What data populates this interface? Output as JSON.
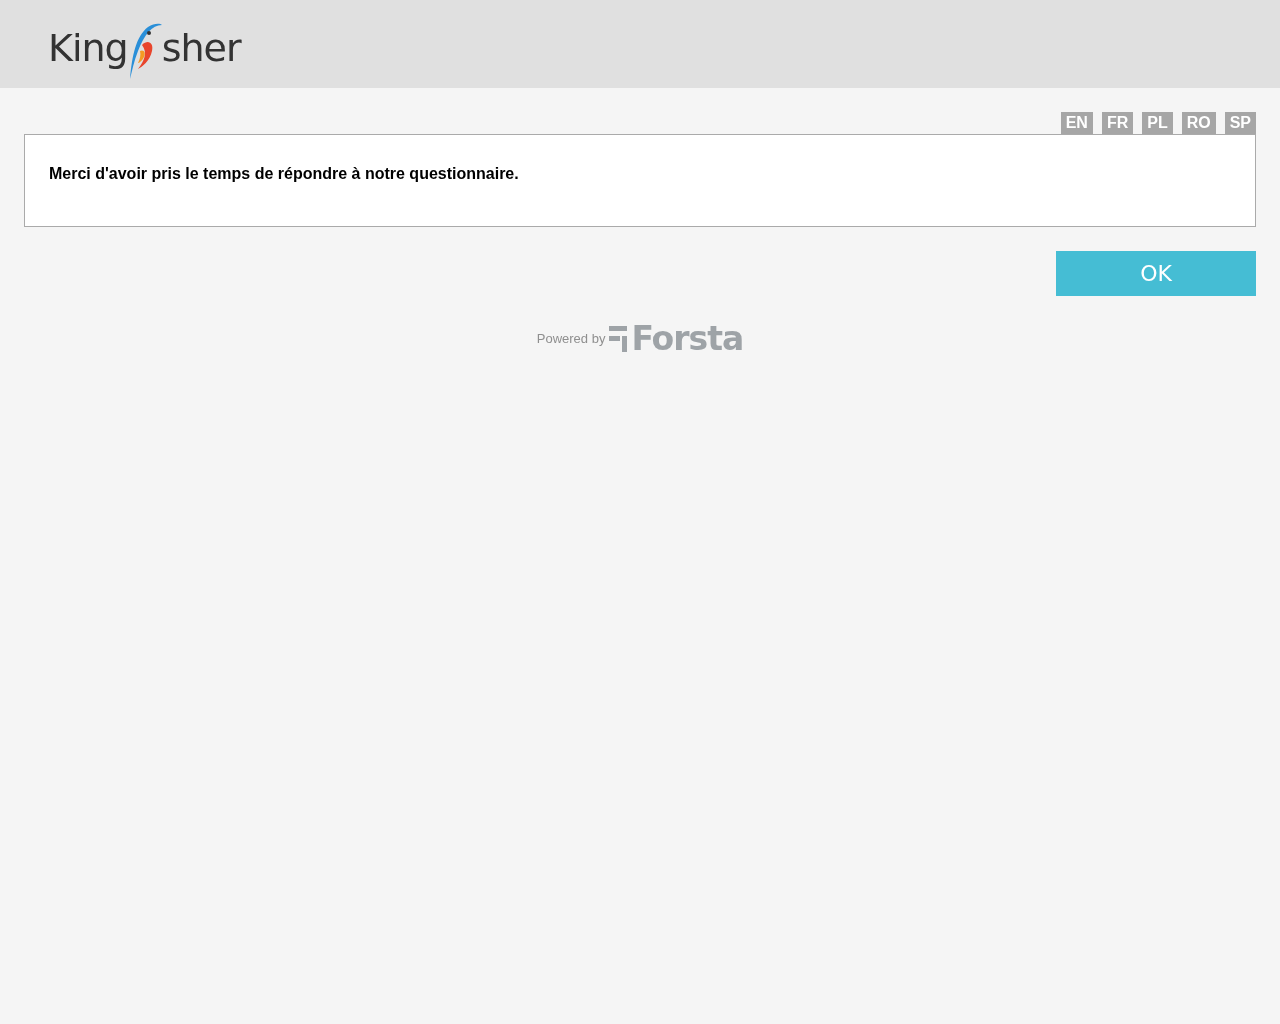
{
  "header": {
    "logo": {
      "before": "King",
      "after": "sher"
    }
  },
  "languages": [
    {
      "label": "EN",
      "selected": false
    },
    {
      "label": "FR",
      "selected": false
    },
    {
      "label": "PL",
      "selected": false
    },
    {
      "label": "RO",
      "selected": false
    },
    {
      "label": "SP",
      "selected": false
    }
  ],
  "message": "Merci d'avoir pris le temps de répondre à notre questionnaire.",
  "buttons": [
    "OK"
  ],
  "footer": {
    "powered_by": "Powered by",
    "brand": "Forsta"
  }
}
